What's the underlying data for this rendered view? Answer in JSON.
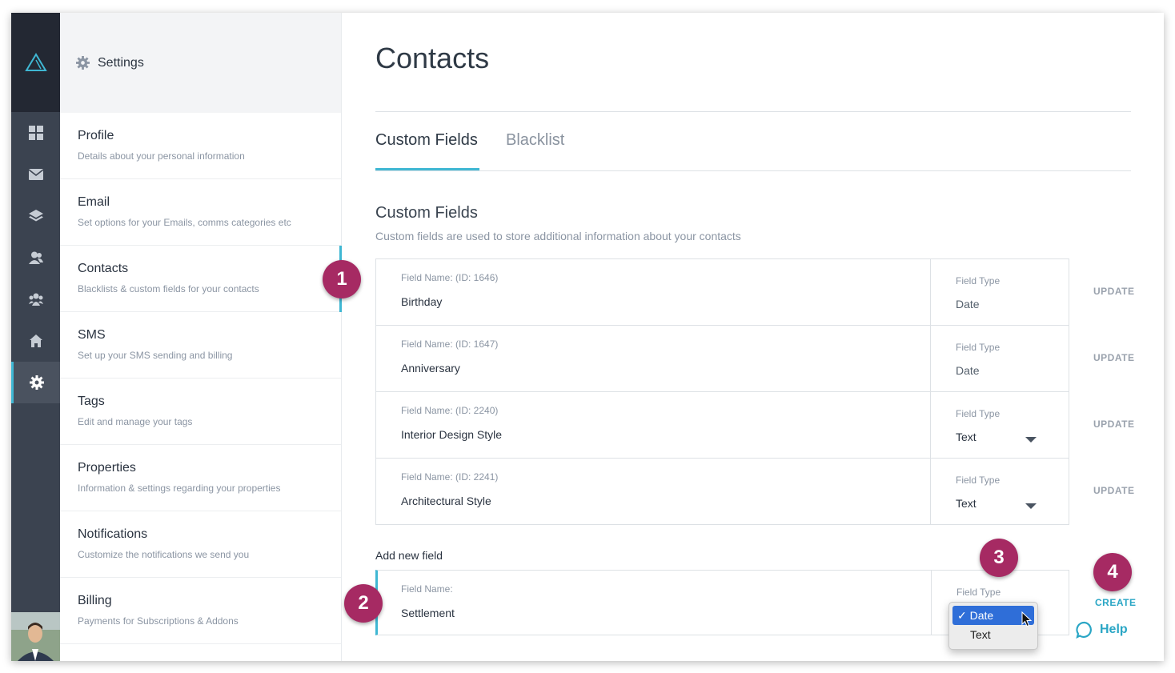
{
  "settings": {
    "title": "Settings",
    "items": [
      {
        "title": "Profile",
        "desc": "Details about your personal information"
      },
      {
        "title": "Email",
        "desc": "Set options for your Emails, comms categories etc"
      },
      {
        "title": "Contacts",
        "desc": "Blacklists & custom fields for your contacts"
      },
      {
        "title": "SMS",
        "desc": "Set up your SMS sending and billing"
      },
      {
        "title": "Tags",
        "desc": "Edit and manage your tags"
      },
      {
        "title": "Properties",
        "desc": "Information & settings regarding your properties"
      },
      {
        "title": "Notifications",
        "desc": "Customize the notifications we send you"
      },
      {
        "title": "Billing",
        "desc": "Payments for Subscriptions & Addons"
      }
    ]
  },
  "rail": {
    "icons": [
      "logo-icon",
      "dashboard-icon",
      "mail-icon",
      "layers-icon",
      "contacts-icon",
      "team-icon",
      "home-icon",
      "gear-icon"
    ],
    "active": "gear-icon"
  },
  "main": {
    "title": "Contacts",
    "tabs": [
      {
        "label": "Custom Fields",
        "active": true
      },
      {
        "label": "Blacklist",
        "active": false
      }
    ],
    "section_title": "Custom Fields",
    "section_desc": "Custom fields are used to store additional information about your contacts",
    "fields": [
      {
        "label": "Field Name: (ID: 1646)",
        "name": "Birthday",
        "type_label": "Field Type",
        "type": "Date",
        "action": "UPDATE"
      },
      {
        "label": "Field Name: (ID: 1647)",
        "name": "Anniversary",
        "type_label": "Field Type",
        "type": "Date",
        "action": "UPDATE"
      },
      {
        "label": "Field Name: (ID: 2240)",
        "name": "Interior Design Style",
        "type_label": "Field Type",
        "type": "Text",
        "action": "UPDATE"
      },
      {
        "label": "Field Name: (ID: 2241)",
        "name": "Architectural Style",
        "type_label": "Field Type",
        "type": "Text",
        "action": "UPDATE"
      }
    ],
    "add_label": "Add new field",
    "new_field": {
      "label": "Field Name:",
      "value": "Settlement",
      "type_label": "Field Type",
      "action": "CREATE"
    },
    "dropdown": {
      "options": [
        "Date",
        "Text"
      ],
      "selected": "Date",
      "check": "✓"
    },
    "help": "Help"
  },
  "badges": [
    "1",
    "2",
    "3",
    "4"
  ],
  "colors": {
    "accent": "#3fb7d3",
    "badge": "#a62a63",
    "rail": "#3b4350",
    "rail_top": "#232833"
  }
}
